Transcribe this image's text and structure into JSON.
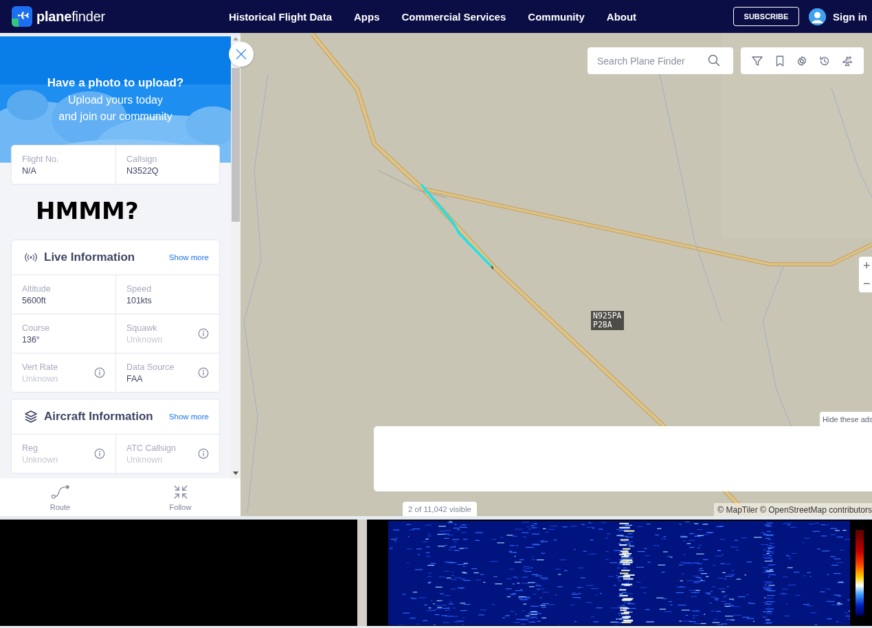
{
  "header": {
    "logo": "**plane**finder",
    "nav": [
      "Historical Flight Data",
      "Apps",
      "Commercial Services",
      "Community",
      "About"
    ],
    "subscribe": "SUBSCRIBE",
    "sign_in": "Sign in"
  },
  "panel": {
    "banner": {
      "title": "Have a photo to upload?",
      "lines": [
        "Upload yours today",
        "and join our community"
      ]
    },
    "flight_fields": [
      {
        "label": "Flight No.",
        "value": "N/A"
      },
      {
        "label": "Callsign",
        "value": "N3522Q"
      }
    ],
    "note": "HMMM?",
    "sections": [
      {
        "title": "Live Information",
        "kind": "live",
        "action": "Show more",
        "fields": [
          {
            "label": "Altitude",
            "value": "5600ft",
            "dimmed": false,
            "info": false
          },
          {
            "label": "Speed",
            "value": "101kts",
            "dimmed": false,
            "info": false
          },
          {
            "label": "Course",
            "value": "136°",
            "dimmed": false,
            "info": false
          },
          {
            "label": "Squawk",
            "value": "Unknown",
            "dimmed": true,
            "info": true
          },
          {
            "label": "Vert Rate",
            "value": "Unknown",
            "dimmed": true,
            "info": true
          },
          {
            "label": "Data Source",
            "value": "FAA",
            "dimmed": false,
            "info": true
          }
        ]
      },
      {
        "title": "Aircraft Information",
        "kind": "aircraft",
        "action": "Show more",
        "fields": [
          {
            "label": "Reg",
            "value": "Unknown",
            "dimmed": true,
            "info": true
          },
          {
            "label": "ATC Callsign",
            "value": "Unknown",
            "dimmed": true,
            "info": true
          }
        ]
      }
    ],
    "actions": [
      {
        "label": "Route",
        "kind": "route"
      },
      {
        "label": "Follow",
        "kind": "follow"
      }
    ]
  },
  "map": {
    "search": {
      "placeholder": "Search Plane Finder"
    },
    "tools": [
      {
        "kind": "filter"
      },
      {
        "kind": "bookmark"
      },
      {
        "kind": "settings"
      },
      {
        "kind": "history"
      },
      {
        "kind": "plane-add"
      }
    ],
    "zoom": [
      "+",
      "−"
    ],
    "aircraft_label": [
      "N925PA",
      "P28A"
    ],
    "hide_ads": "Hide these ads",
    "visible_count": "2 of 11,042 visible",
    "attribution": "© MapTiler © OpenStreetMap contributors"
  }
}
